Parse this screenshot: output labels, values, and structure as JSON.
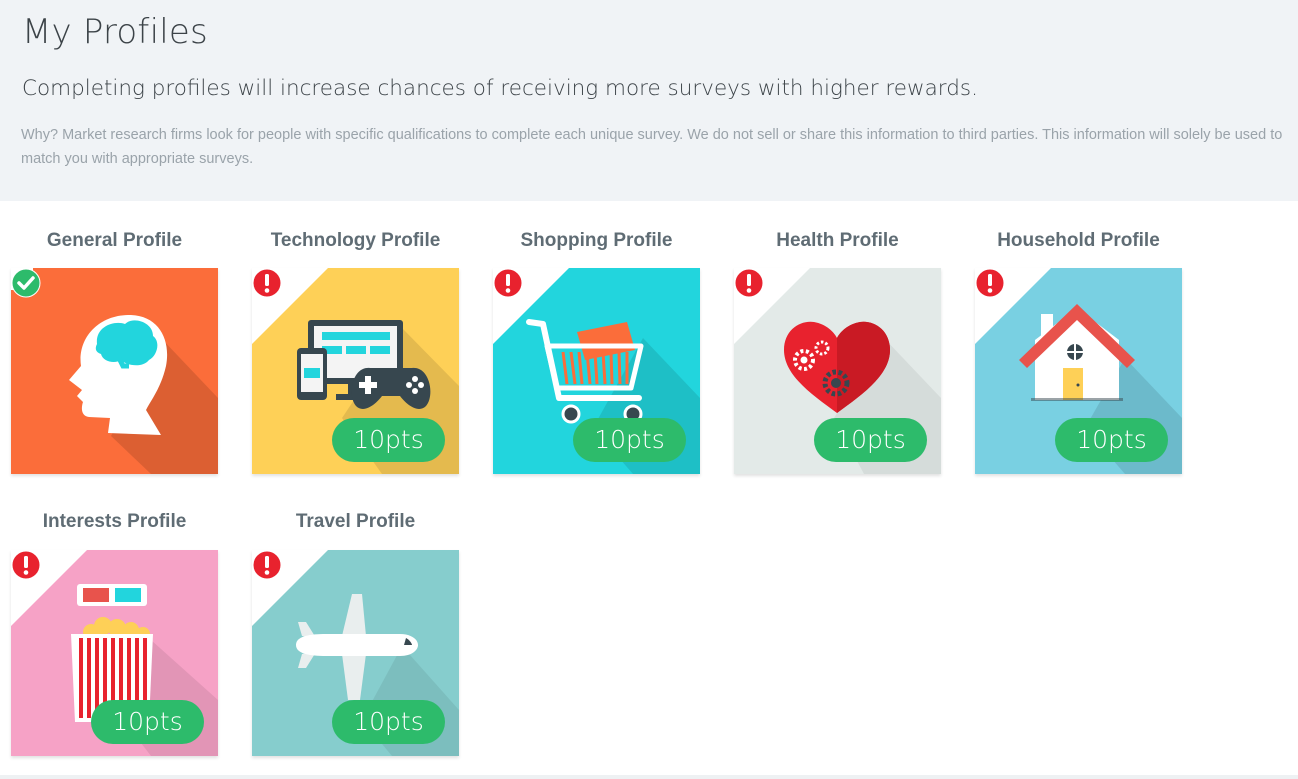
{
  "header": {
    "title": "My Profiles",
    "subtitle": "Completing profiles will increase chances of receiving more surveys with higher rewards.",
    "note": "Why? Market research firms look for people with specific qualifications to complete each unique survey. We do not sell or share this information to third parties. This information will solely be used to match you with appropriate surveys."
  },
  "profiles": [
    {
      "title": "General Profile",
      "status": "complete",
      "icon": "head-brain-icon",
      "color": "#fb6d3a"
    },
    {
      "title": "Technology Profile",
      "status": "incomplete",
      "points": "10pts",
      "icon": "devices-icon",
      "color": "#fed057"
    },
    {
      "title": "Shopping Profile",
      "status": "incomplete",
      "points": "10pts",
      "icon": "shopping-cart-icon",
      "color": "#22d5dd"
    },
    {
      "title": "Health Profile",
      "status": "incomplete",
      "points": "10pts",
      "icon": "heart-gears-icon",
      "color": "#e3eae8"
    },
    {
      "title": "Household Profile",
      "status": "incomplete",
      "points": "10pts",
      "icon": "house-icon",
      "color": "#79d0e2"
    },
    {
      "title": "Interests Profile",
      "status": "incomplete",
      "points": "10pts",
      "icon": "popcorn-3d-glasses-icon",
      "color": "#f6a2c6"
    },
    {
      "title": "Travel Profile",
      "status": "incomplete",
      "points": "10pts",
      "icon": "airplane-icon",
      "color": "#86cdcd"
    }
  ],
  "colors": {
    "points_badge": "#2dbb6b",
    "complete_badge": "#2dbb6b",
    "incomplete_badge": "#e8222e"
  }
}
